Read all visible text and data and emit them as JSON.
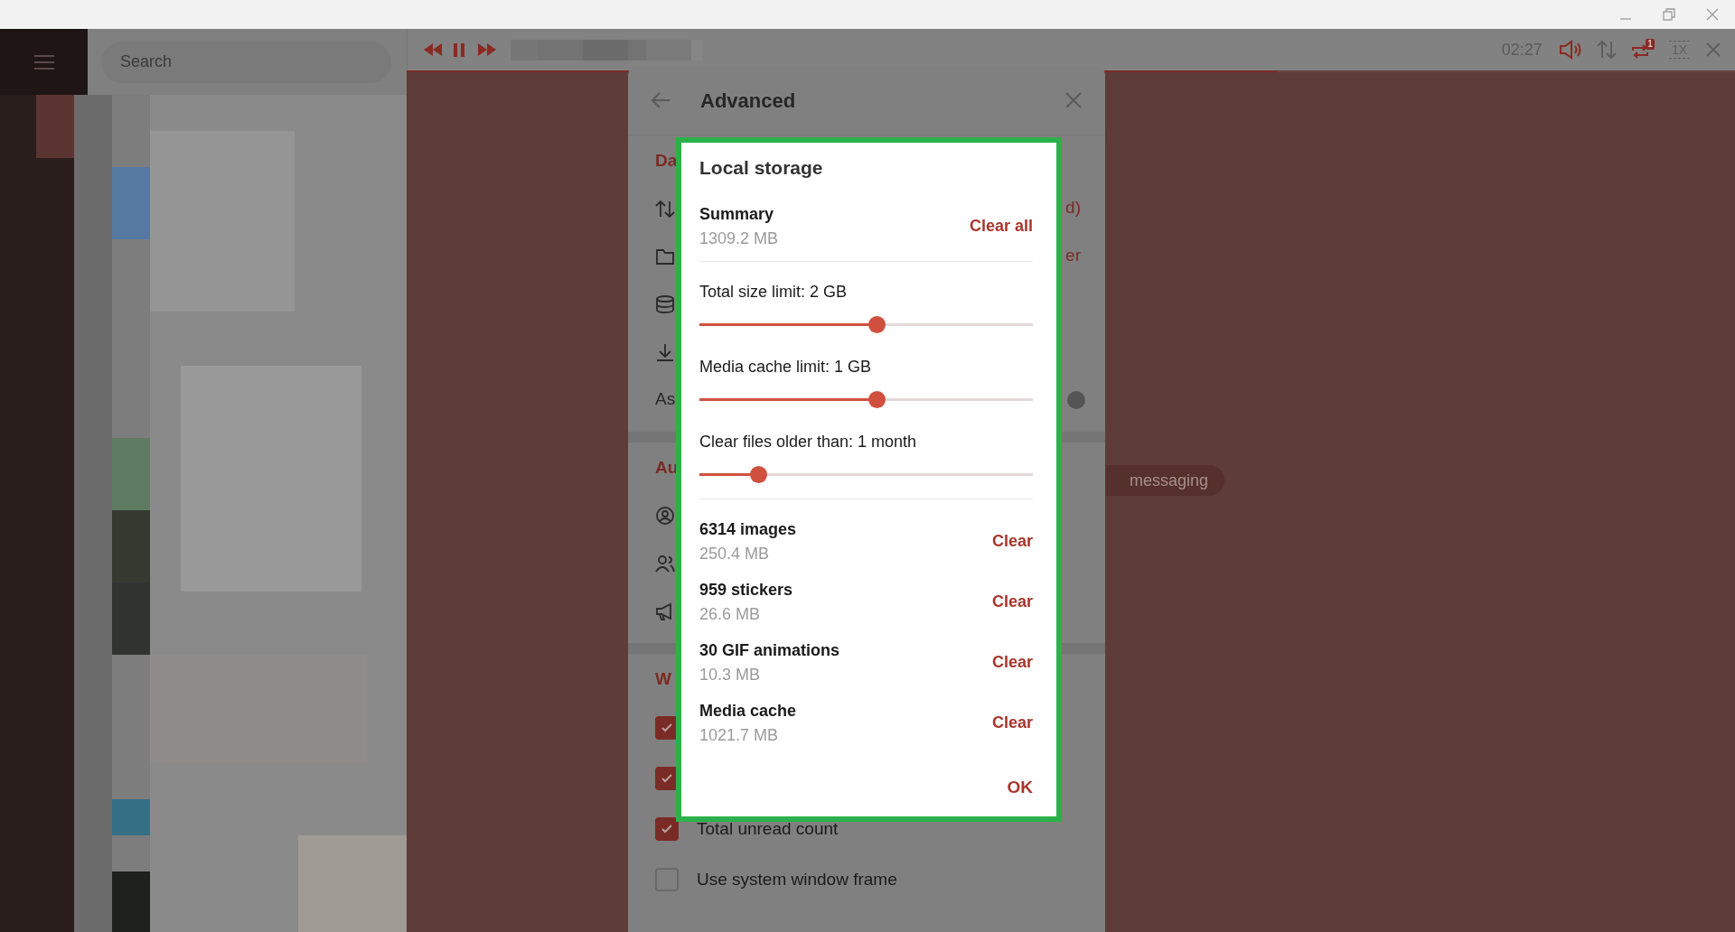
{
  "sidebar": {
    "search": {
      "placeholder": "Search"
    }
  },
  "player": {
    "time": "02:27",
    "repeat_badge": "1",
    "speed": "1X",
    "level": 0.655
  },
  "chat": {
    "service_message": "messaging"
  },
  "settings_panel": {
    "title": "Advanced",
    "sections": [
      {
        "heading": "Da",
        "rows": [
          {
            "kind": "icon",
            "trailing": "d)"
          },
          {
            "kind": "icon",
            "trailing": "er"
          },
          {
            "kind": "icon"
          },
          {
            "kind": "icon"
          },
          {
            "kind": "toggle",
            "label": "As"
          }
        ]
      },
      {
        "heading": "Au",
        "rows": [
          {
            "kind": "icon"
          },
          {
            "kind": "icon"
          },
          {
            "kind": "icon"
          }
        ]
      },
      {
        "heading": "W",
        "rows": [
          {
            "kind": "checkbox",
            "checked": true
          },
          {
            "kind": "checkbox",
            "checked": true
          },
          {
            "kind": "checkbox",
            "label": "Total unread count",
            "checked": true
          },
          {
            "kind": "checkbox",
            "label": "Use system window frame",
            "checked": false
          }
        ]
      }
    ]
  },
  "dialog": {
    "title": "Local storage",
    "summary": {
      "label": "Summary",
      "size": "1309.2 MB",
      "action": "Clear all"
    },
    "limits": [
      {
        "label": "Total size limit: 2 GB",
        "level": 0.53
      },
      {
        "label": "Media cache limit: 1 GB",
        "level": 0.53
      },
      {
        "label": "Clear files older than: 1 month",
        "level": 0.177
      }
    ],
    "items": [
      {
        "name": "6314 images",
        "size": "250.4 MB",
        "action": "Clear"
      },
      {
        "name": "959 stickers",
        "size": "26.6 MB",
        "action": "Clear"
      },
      {
        "name": "30 GIF animations",
        "size": "10.3 MB",
        "action": "Clear"
      },
      {
        "name": "Media cache",
        "size": "1021.7 MB",
        "action": "Clear"
      }
    ],
    "ok": "OK"
  }
}
